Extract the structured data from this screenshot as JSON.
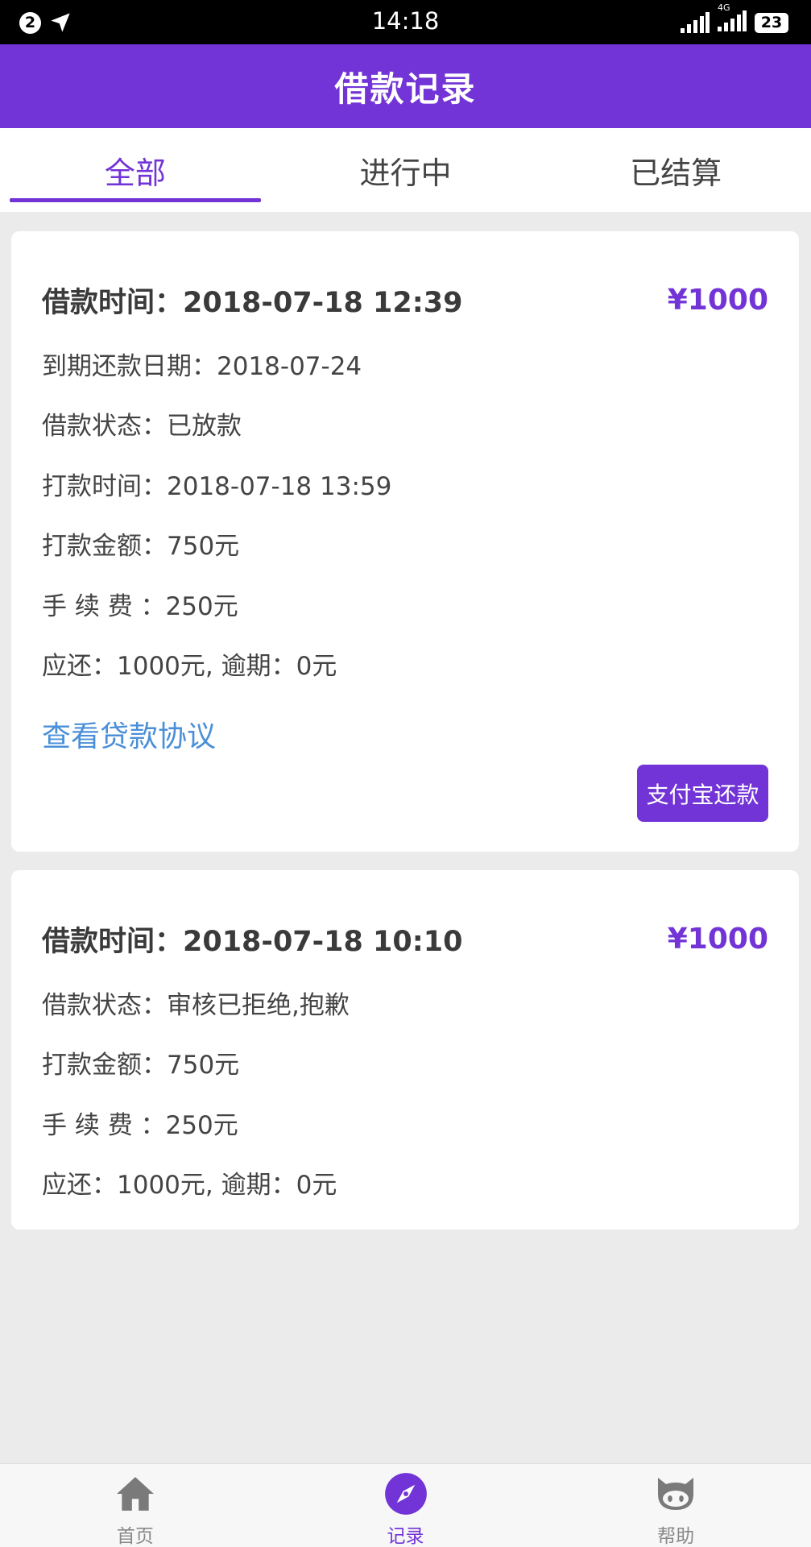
{
  "status_bar": {
    "notification_count": "2",
    "time": "14:18",
    "network_label": "4G",
    "battery": "23"
  },
  "header": {
    "title": "借款记录"
  },
  "tabs": [
    {
      "label": "全部",
      "active": true
    },
    {
      "label": "进行中",
      "active": false
    },
    {
      "label": "已结算",
      "active": false
    }
  ],
  "loans": [
    {
      "time_label": "借款时间：2018-07-18 12:39",
      "amount": "¥1000",
      "rows": [
        "到期还款日期：2018-07-24",
        "借款状态：已放款",
        "打款时间：2018-07-18 13:59",
        "打款金额：750元",
        "手 续 费 ：250元",
        "应还：1000元, 逾期：0元"
      ],
      "agreement_link": "查看贷款协议",
      "pay_button": "支付宝还款"
    },
    {
      "time_label": "借款时间：2018-07-18 10:10",
      "amount": "¥1000",
      "rows": [
        "借款状态：审核已拒绝,抱歉",
        "打款金额：750元",
        "手 续 费 ：250元",
        "应还：1000元, 逾期：0元"
      ]
    }
  ],
  "bottom_nav": [
    {
      "label": "首页",
      "icon": "home-icon",
      "active": false
    },
    {
      "label": "记录",
      "icon": "compass-icon",
      "active": true
    },
    {
      "label": "帮助",
      "icon": "github-cat-icon",
      "active": false
    }
  ],
  "colors": {
    "primary": "#7234d6",
    "link": "#4a8fd8",
    "background": "#ebebeb"
  }
}
